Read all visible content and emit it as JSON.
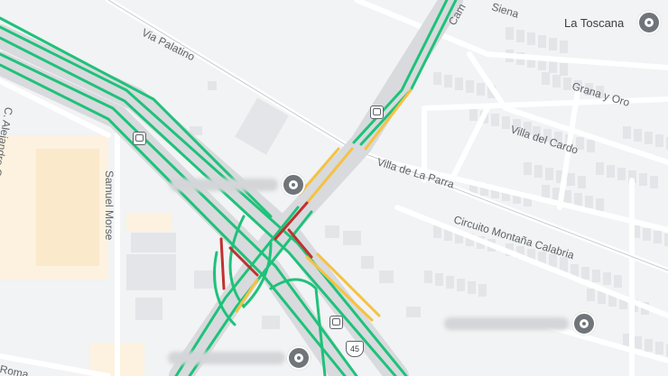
{
  "map": {
    "colors": {
      "road_free": "#1ec27a",
      "road_slow": "#f5c242",
      "road_heavy": "#c0312e",
      "land": "#f1f3f4",
      "building": "#e3e5e8",
      "industrial": "#fdf2df"
    },
    "streets": [
      {
        "id": "via-palatino",
        "label": "Via Palatino"
      },
      {
        "id": "samuel-morse",
        "label": "Samuel Morse"
      },
      {
        "id": "alejandro-graham-bell",
        "label": "C. Alejandro Graham Bell"
      },
      {
        "id": "villa-de-la-parra",
        "label": "Villa de La Parra"
      },
      {
        "id": "villa-del-cardo",
        "label": "Villa del Cardo"
      },
      {
        "id": "circuito-montana-calabria",
        "label": "Circuito Montaña Calabria"
      },
      {
        "id": "grana-y-oro",
        "label": "Grana y Oro"
      },
      {
        "id": "siena",
        "label": "Siena"
      },
      {
        "id": "camino",
        "label": "Cam"
      },
      {
        "id": "romano",
        "label": "Roma"
      }
    ],
    "places": [
      {
        "id": "la-toscana",
        "label": "La Toscana",
        "icon": "place-pin-icon"
      },
      {
        "id": "residencial-place",
        "label": "Residencial Las Cisnes",
        "icon": "place-pin-icon",
        "blurred": true
      },
      {
        "id": "center-place",
        "label": "",
        "icon": "education-pin-icon",
        "blurred": true
      },
      {
        "id": "bottom-place",
        "label": "",
        "icon": "place-pin-icon",
        "blurred": true
      }
    ],
    "highway_shield": "45",
    "bus_stop_icon": "bus-stop-icon"
  }
}
